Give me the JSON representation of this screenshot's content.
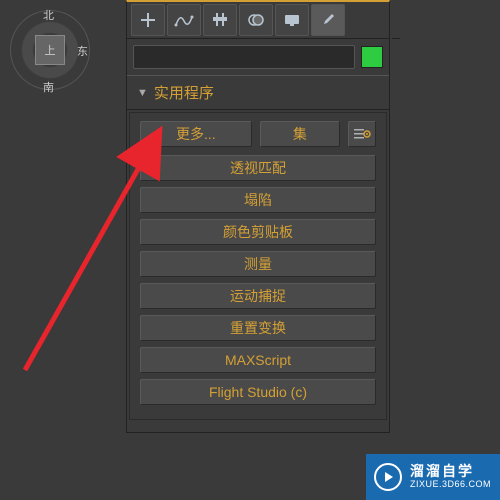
{
  "viewcube": {
    "north": "北",
    "east": "东",
    "south": "南",
    "face": "上"
  },
  "toolbar": {
    "icons": [
      "plus-icon",
      "path-icon",
      "compound-icon",
      "boolean-icon",
      "monitor-icon",
      "wrench-icon"
    ]
  },
  "search": {
    "placeholder": ""
  },
  "color_swatch": "#2ecc40",
  "rollout": {
    "title": "实用程序",
    "buttons": {
      "more": "更多...",
      "set": "集"
    },
    "utilities": [
      "透视匹配",
      "塌陷",
      "颜色剪贴板",
      "测量",
      "运动捕捉",
      "重置变换",
      "MAXScript",
      "Flight Studio (c)"
    ]
  },
  "watermark": {
    "main": "溜溜自学",
    "sub": "ZIXUE.3D66.COM"
  }
}
